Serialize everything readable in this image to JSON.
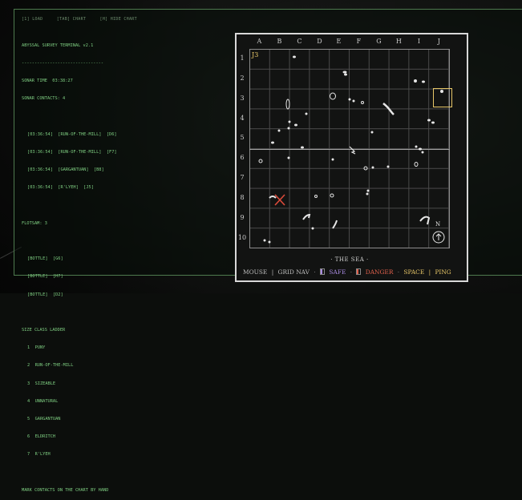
{
  "tabs": [
    "[1] LOAD",
    "[TAB] CHART",
    "[H] HIDE CHART"
  ],
  "terminal": {
    "title": "ABYSSAL SURVEY TERMINAL v2.1",
    "divider": "--------------------------------",
    "sonar_time_label": "SONAR TIME",
    "sonar_time": "03:38:27",
    "contacts_label": "SONAR CONTACTS:",
    "contacts_count": "4",
    "contacts": [
      "[03:36:54]  [RUN-OF-THE-MILL]  [D6]",
      "[03:36:54]  [RUN-OF-THE-MILL]  [F7]",
      "[03:36:54]  [GARGANTUAN]  [B8]",
      "[03:36:54]  [R'LYEH]  [J5]"
    ],
    "flotsam_label": "FLOTSAM:",
    "flotsam_count": "3",
    "bottles": [
      "[BOTTLE]  [G6]",
      "[BOTTLE]  [H7]",
      "[BOTTLE]  [D2]"
    ],
    "ladder_title": "SIZE CLASS LADDER",
    "ladder": [
      "1  PUNY",
      "2  RUN-OF-THE-MILL",
      "3  SIZEABLE",
      "4  UNNATURAL",
      "5  GARGANTUAN",
      "6  ELDRITCH",
      "7  R'LYEH"
    ],
    "footer_note": "MARK CONTACTS ON THE CHART BY HAND"
  },
  "map": {
    "columns": [
      "A",
      "B",
      "C",
      "D",
      "E",
      "F",
      "G",
      "H",
      "I",
      "J"
    ],
    "rows": [
      "1",
      "2",
      "3",
      "4",
      "5",
      "6",
      "7",
      "8",
      "9",
      "10"
    ],
    "cursor_cell": "J3",
    "title": "· THE SEA ·",
    "compass": "N",
    "legend": {
      "mouse": "MOUSE",
      "grid_nav": "GRID NAV",
      "safe": "SAFE",
      "danger": "DANGER",
      "space": "SPACE",
      "ping": "PING"
    },
    "colors": {
      "highlight": "#e8c768",
      "safe": "#a88ae0",
      "danger": "#e0604c",
      "marker": "#d94a3a",
      "terminal_text": "#7fcf82"
    }
  }
}
